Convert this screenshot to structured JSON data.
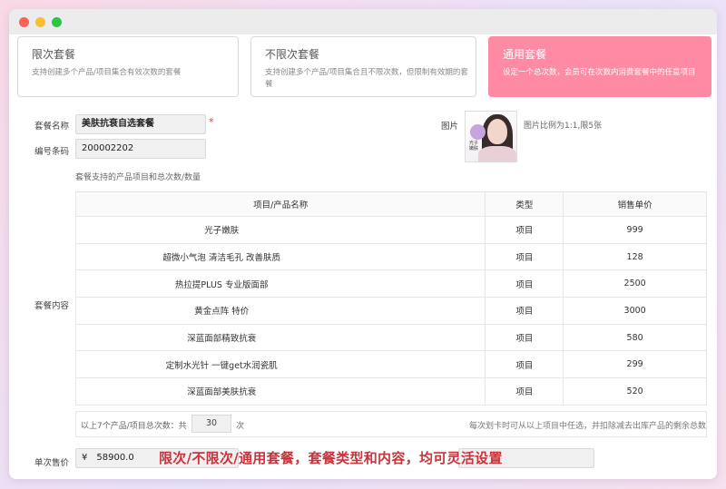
{
  "cards": [
    {
      "title": "限次套餐",
      "desc": "支持创建多个产品/项目集合有效次数的套餐"
    },
    {
      "title": "不限次套餐",
      "desc": "支持创建多个产品/项目集合且不限次数，但限制有效期的套餐"
    },
    {
      "title": "通用套餐",
      "desc": "设定一个总次数，会员可在次数内消费套餐中的任意项目"
    }
  ],
  "form": {
    "name_label": "套餐名称",
    "name_value": "美肤抗衰自选套餐",
    "required_mark": "*",
    "code_label": "编号条码",
    "code_value": "200002202",
    "image_label": "图片",
    "image_hint": "图片比例为1:1,限5张",
    "thumb_text": "光子嫩肤",
    "items_hint": "套餐支持的产品项目和总次数/数量",
    "content_label": "套餐内容",
    "price_label": "单次售价",
    "price_currency": "¥",
    "price_value": "58900.0"
  },
  "table": {
    "headers": [
      "项目/产品名称",
      "类型",
      "销售单价"
    ],
    "rows": [
      {
        "name": "光子嫩肤",
        "type": "项目",
        "price": "999"
      },
      {
        "name": "超微小气泡 清洁毛孔 改善肤质",
        "type": "项目",
        "price": "128"
      },
      {
        "name": "热拉提PLUS 专业版面部",
        "type": "项目",
        "price": "2500"
      },
      {
        "name": "黄金点阵 特价",
        "type": "项目",
        "price": "3000"
      },
      {
        "name": "深蓝面部精致抗衰",
        "type": "项目",
        "price": "580"
      },
      {
        "name": "定制水光针 一键get水润瓷肌",
        "type": "项目",
        "price": "299"
      },
      {
        "name": "深蓝面部美肤抗衰",
        "type": "项目",
        "price": "520"
      }
    ]
  },
  "summary": {
    "prefix": "以上7个产品/项目总次数：共",
    "total": "30",
    "suffix": "次",
    "note": "每次划卡时可从以上项目中任选，并扣除减去出库产品的剩余总数"
  },
  "banner": "限次/不限次/通用套餐，套餐类型和内容，均可灵活设置",
  "colors": {
    "accent": "#ff8aa4",
    "banner": "#c8343d",
    "required": "#e0393e"
  }
}
